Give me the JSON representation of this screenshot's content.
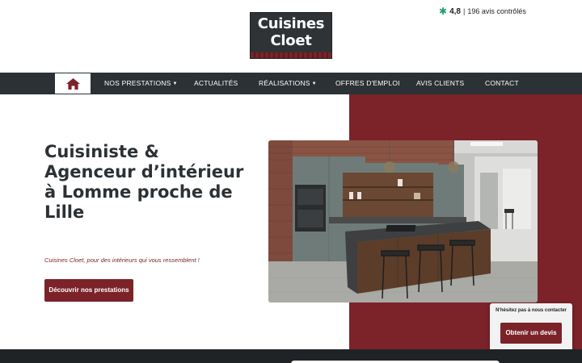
{
  "brand": {
    "line1": "Cuisines",
    "line2": "Cloet",
    "colors": {
      "primary": "#7b2329",
      "dark": "#2b3134",
      "star": "#1fa36b"
    }
  },
  "rating": {
    "icon": "star-icon",
    "score": "4,8",
    "separator": "|",
    "text": "196 avis contrôlés"
  },
  "nav": {
    "home_icon": "home-icon",
    "items": [
      {
        "label": "NOS PRESTATIONS",
        "dropdown": true
      },
      {
        "label": "ACTUALITÉS",
        "dropdown": false
      },
      {
        "label": "RÉALISATIONS",
        "dropdown": true
      },
      {
        "label": "OFFRES D'EMPLOI",
        "dropdown": false
      },
      {
        "label": "AVIS CLIENTS",
        "dropdown": false
      },
      {
        "label": "CONTACT",
        "dropdown": false
      }
    ],
    "caret": "▼"
  },
  "hero": {
    "title": "Cuisiniste & Agenceur d’intérieur à Lomme proche de Lille",
    "subtitle": "Cuisines Cloet, pour des intérieurs qui vous ressemblent !",
    "cta": "Découvrir nos prestations"
  },
  "contact_widget": {
    "text": "N'hésitez pas à nous contacter",
    "button": "Obtenir un devis"
  }
}
